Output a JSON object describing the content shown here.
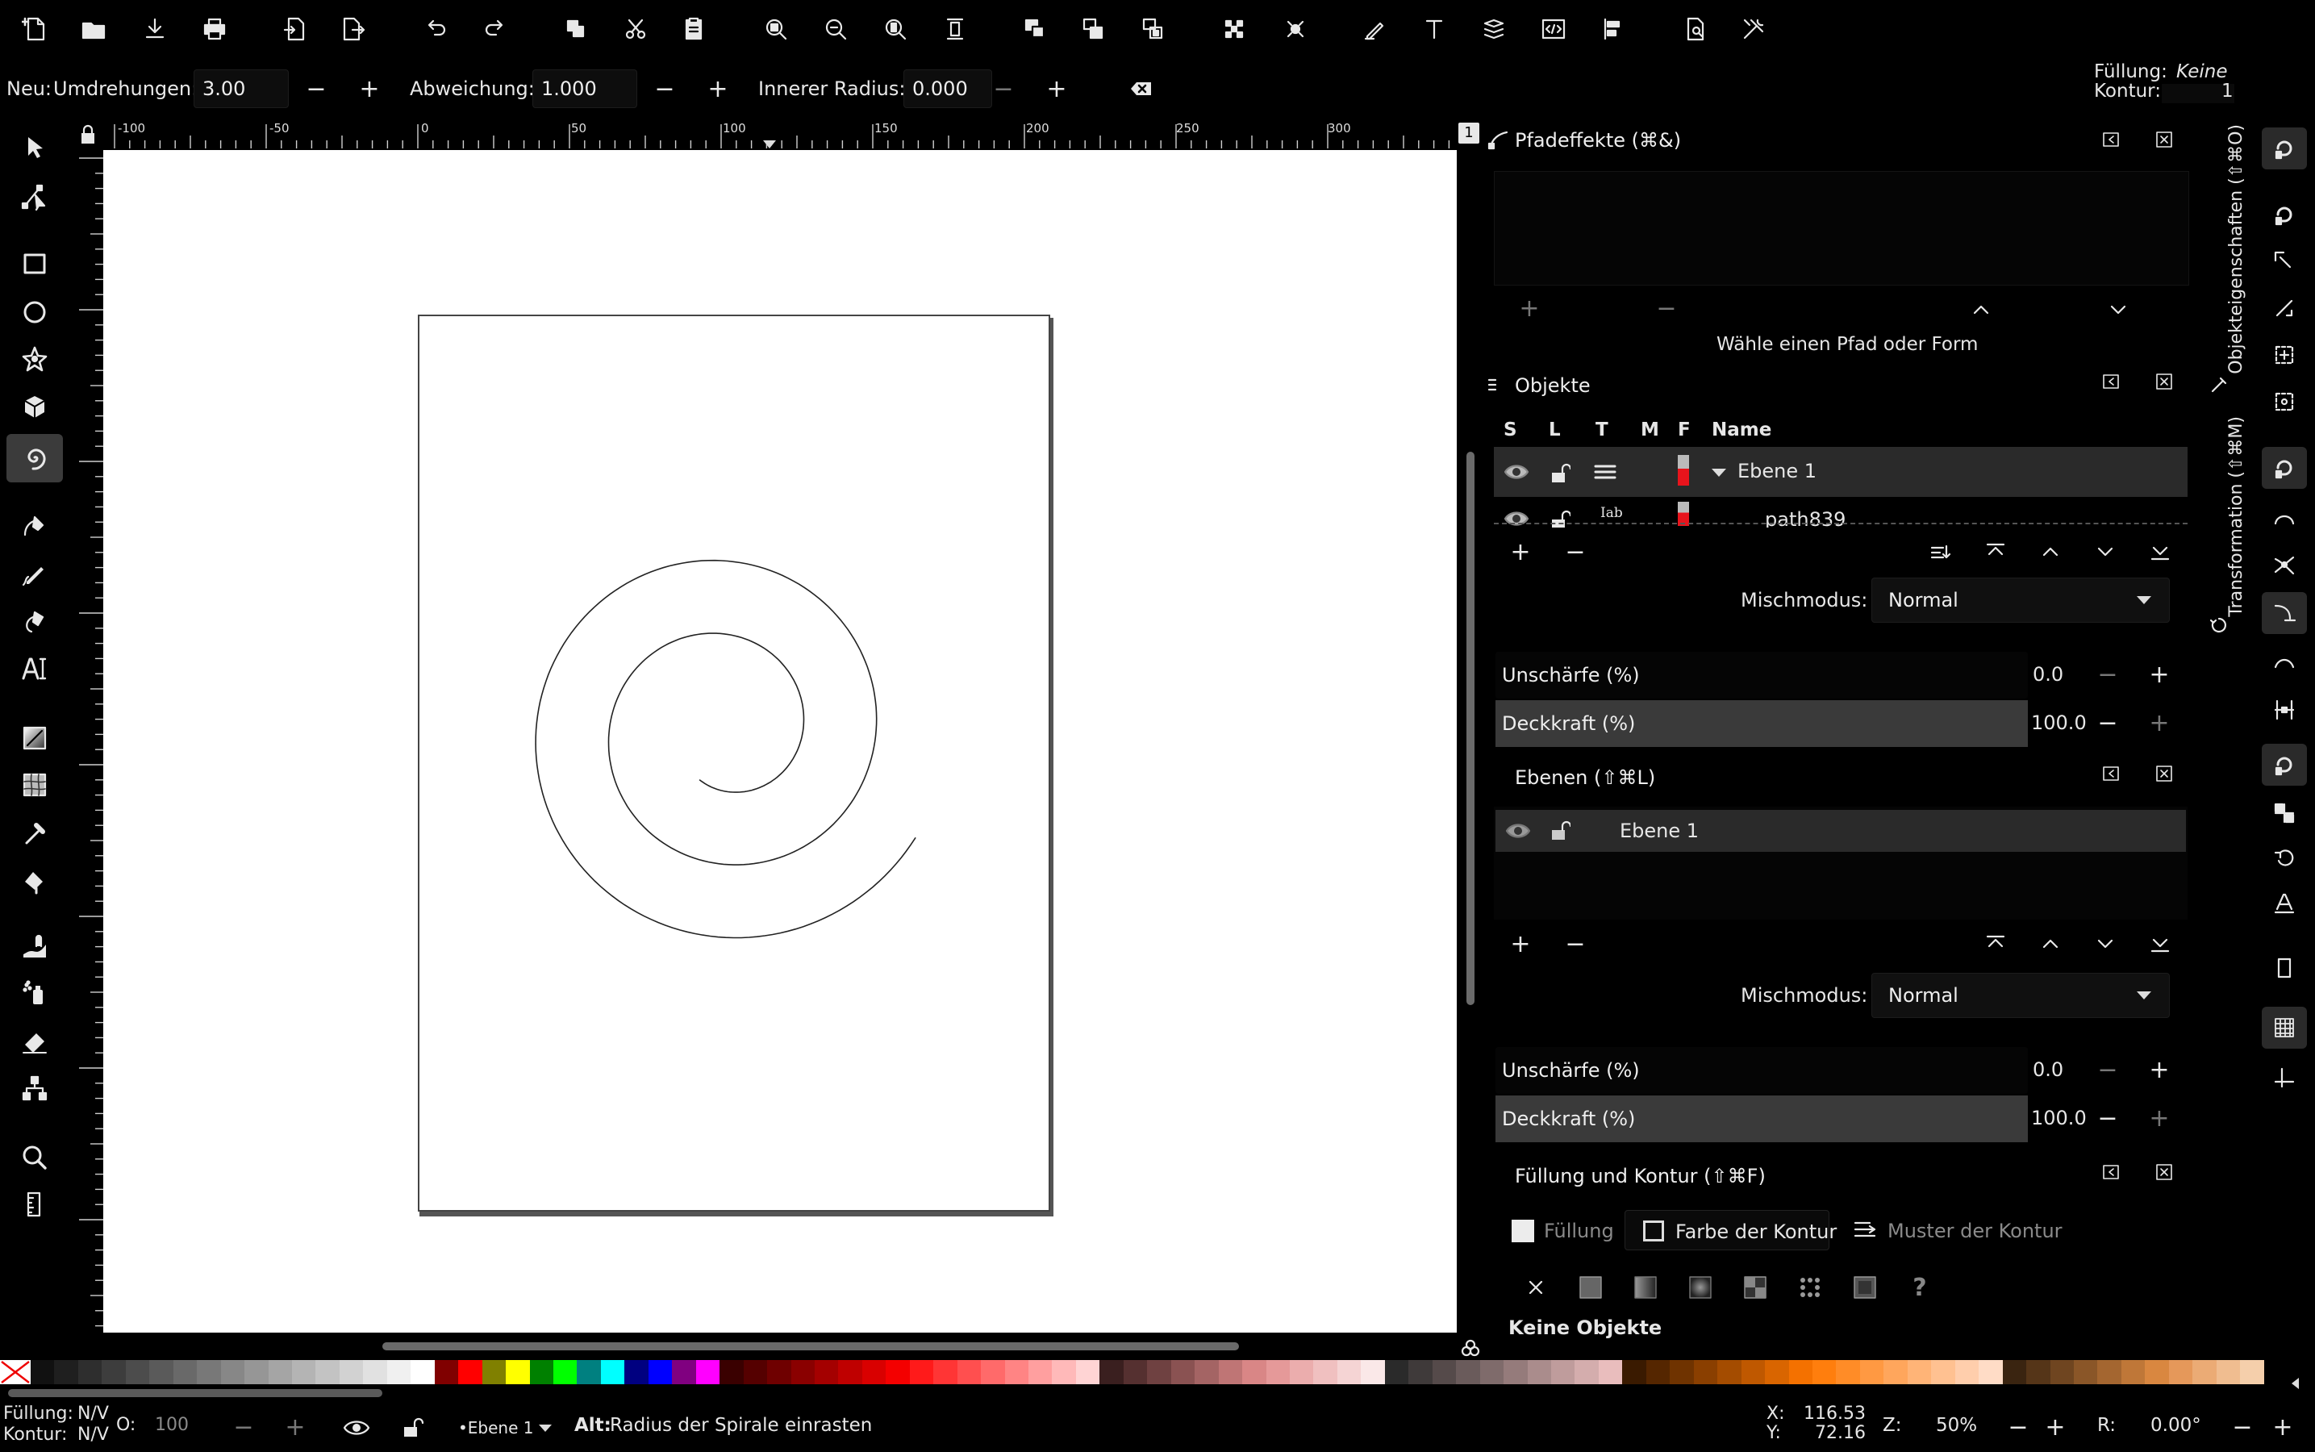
{
  "commands_bar": {
    "icons": [
      "new-document-icon",
      "open-icon",
      "save-icon",
      "print-icon",
      "import-icon",
      "export-icon",
      "undo-icon",
      "redo-icon",
      "duplicate-icon",
      "cut-icon",
      "paste-icon",
      "zoom-selection-icon",
      "zoom-drawing-icon",
      "zoom-page-icon",
      "zoom-width-icon",
      "group-icon",
      "ungroup-icon",
      "clone-icon",
      "node-align-icon",
      "node-distribute-icon",
      "fill-stroke-icon",
      "text-font-icon",
      "layers-icon",
      "xml-editor-icon",
      "align-distribute-icon",
      "document-properties-icon",
      "preferences-icon"
    ]
  },
  "tool_controls": {
    "new_label": "Neu:",
    "turns_label": "Umdrehungen:",
    "turns_value": "3.00",
    "divergence_label": "Abweichung:",
    "divergence_value": "1.000",
    "inner_radius_label": "Innerer Radius:",
    "inner_radius_value": "0.000",
    "minus": "−",
    "plus": "+"
  },
  "style_indicator": {
    "fill_label": "Füllung:",
    "fill_value": "Keine",
    "stroke_label": "Kontur:",
    "stroke_value": "1"
  },
  "ruler": {
    "labels": [
      "-100",
      "-50",
      "0",
      "50",
      "100",
      "150",
      "200",
      "250",
      "300"
    ],
    "corner_badge": "1"
  },
  "toolbox": {
    "tools": [
      "selector-tool-icon",
      "node-tool-icon",
      "rectangle-tool-icon",
      "ellipse-tool-icon",
      "star-tool-icon",
      "3d-box-tool-icon",
      "spiral-tool-icon",
      "bezier-tool-icon",
      "pencil-tool-icon",
      "calligraphy-tool-icon",
      "text-tool-icon",
      "gradient-tool-icon",
      "mesh-tool-icon",
      "dropper-tool-icon",
      "paint-bucket-tool-icon",
      "tweak-tool-icon",
      "spray-tool-icon",
      "eraser-tool-icon",
      "connector-tool-icon",
      "zoom-tool-icon",
      "measure-tool-icon"
    ],
    "active_tool": "spiral-tool-icon"
  },
  "path_effects": {
    "title": "Pfadeffekte (⌘&)",
    "hint": "Wähle einen Pfad oder Form",
    "buttons": [
      "+",
      "−",
      "⌃",
      "⌄"
    ]
  },
  "objects": {
    "title": "Objekte",
    "columns": [
      "S",
      "L",
      "T",
      "M",
      "F",
      "Name"
    ],
    "rows": [
      {
        "name": "Ebene 1",
        "type_icon": "layer-stack-icon"
      },
      {
        "name": "path839",
        "type_icon": "label-icon",
        "type_text": "Iab"
      }
    ],
    "blend_label": "Mischmodus:",
    "blend_value": "Normal",
    "blur_label": "Unschärfe (%)",
    "blur_value": "0.0",
    "opacity_label": "Deckkraft (%)",
    "opacity_value": "100.0",
    "opacity_level": 1.0
  },
  "layers": {
    "title": "Ebenen (⇧⌘L)",
    "rows": [
      {
        "name": "Ebene 1"
      }
    ],
    "blend_label": "Mischmodus:",
    "blend_value": "Normal",
    "blur_label": "Unschärfe (%)",
    "blur_value": "0.0",
    "opacity_label": "Deckkraft (%)",
    "opacity_value": "100.0",
    "opacity_level": 1.0
  },
  "fill_stroke": {
    "title": "Füllung und Kontur (⇧⌘F)",
    "tabs": [
      "Füllung",
      "Farbe der Kontur",
      "Muster der Kontur"
    ],
    "active_tab": "Farbe der Kontur",
    "paint_buttons": [
      "no-paint-icon",
      "flat-color-icon",
      "linear-gradient-icon",
      "radial-gradient-icon",
      "pattern-icon",
      "swatch-icon",
      "mesh-icon",
      "unset-icon"
    ],
    "no_objects": "Keine Objekte"
  },
  "side_tabs": {
    "object_properties": "Objekteigenschaften (⇧⌘O)",
    "transform": "Transformation (⇧⌘M)"
  },
  "palette": {
    "colors": [
      "#111111",
      "#1f1f1f",
      "#2e2e2e",
      "#3d3d3d",
      "#4c4c4c",
      "#5a5a5a",
      "#696969",
      "#787878",
      "#878787",
      "#969696",
      "#a5a5a5",
      "#b4b4b4",
      "#c3c3c3",
      "#d2d2d2",
      "#e1e1e1",
      "#f0f0f0",
      "#ffffff",
      "#800000",
      "#ff0000",
      "#808000",
      "#ffff00",
      "#008000",
      "#00ff00",
      "#008080",
      "#00ffff",
      "#000080",
      "#0000ff",
      "#800080",
      "#ff00ff",
      "#3a0000",
      "#550000",
      "#6f0000",
      "#8a0000",
      "#a40000",
      "#bf0000",
      "#d90000",
      "#f40000",
      "#ff1a1a",
      "#ff3535",
      "#ff4f4f",
      "#ff6a6a",
      "#ff8484",
      "#ff9f9f",
      "#ffb9b9",
      "#ffd4d4",
      "#3a1f1f",
      "#553030",
      "#6f4141",
      "#8a5252",
      "#a46464",
      "#bf7575",
      "#d98686",
      "#e59999",
      "#ebadad",
      "#f0c0c0",
      "#f5d4d4",
      "#fae8e8",
      "#2a2a2a",
      "#3f3a3a",
      "#554a4a",
      "#6a5b5b",
      "#7f6b6b",
      "#957b7b",
      "#aa8c8c",
      "#bf9c9c",
      "#d4adad",
      "#e9bdbd",
      "#3a1a00",
      "#552600",
      "#6f3300",
      "#8a3f00",
      "#a44c00",
      "#bf5800",
      "#d96500",
      "#f47100",
      "#ff7e0d",
      "#ff8c27",
      "#ff9942",
      "#ffa65c",
      "#ffb477",
      "#ffc191",
      "#ffceac",
      "#ffdcc6",
      "#3a2410",
      "#553518",
      "#6f4520",
      "#8a5628",
      "#a46630",
      "#bf7738",
      "#d98740",
      "#e5985a",
      "#ebab75",
      "#f0bd90",
      "#f5cfab"
    ]
  },
  "statusbar": {
    "fill_label": "Füllung:",
    "fill_value": "N/V",
    "stroke_label": "Kontur:",
    "stroke_value": "N/V",
    "opacity_label": "O:",
    "opacity_value": "100",
    "layer_name": "•Ebene 1",
    "message_bold": "Alt:",
    "message": " Radius der Spirale einrasten",
    "x_label": "X:",
    "x_value": "116.53",
    "y_label": "Y:",
    "y_value": "72.16",
    "zoom_label": "Z:",
    "zoom_value": "50%",
    "rotation_label": "R:",
    "rotation_value": "0.00°"
  }
}
